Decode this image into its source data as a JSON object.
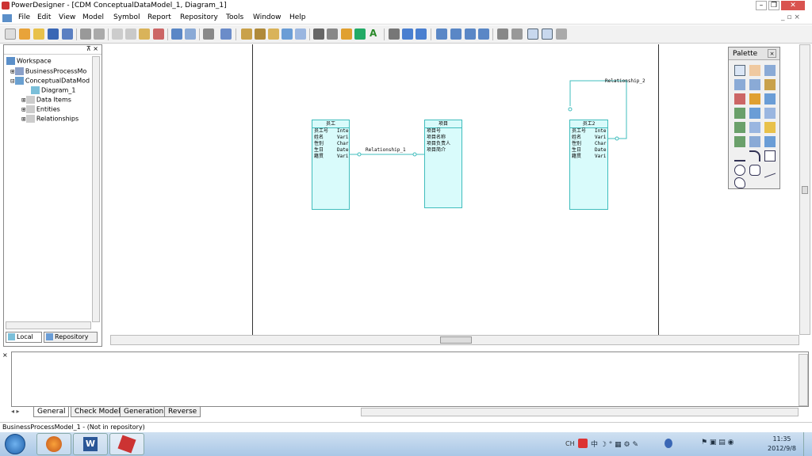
{
  "app": {
    "title": "PowerDesigner - [CDM ConceptualDataModel_1, Diagram_1]"
  },
  "menu": [
    "File",
    "Edit",
    "View",
    "Model",
    "Symbol",
    "Report",
    "Repository",
    "Tools",
    "Window",
    "Help"
  ],
  "tree": {
    "items": [
      {
        "label": "Workspace"
      },
      {
        "label": "BusinessProcessMo"
      },
      {
        "label": "ConceptualDataMod"
      },
      {
        "label": "Diagram_1"
      },
      {
        "label": "Data Items"
      },
      {
        "label": "Entities"
      },
      {
        "label": "Relationships"
      }
    ],
    "tabs": [
      "Local",
      "Repository"
    ]
  },
  "entities": [
    {
      "name": "员工",
      "rows": [
        [
          "员工号",
          "Inte"
        ],
        [
          "姓名",
          "Vari"
        ],
        [
          "性别",
          "Char"
        ],
        [
          "生日",
          "Date"
        ],
        [
          "籍贯",
          "Vari"
        ]
      ]
    },
    {
      "name": "项目",
      "rows": [
        [
          "项目号",
          ""
        ],
        [
          "项目名称",
          ""
        ],
        [
          "项目负责人",
          ""
        ],
        [
          "项目简介",
          ""
        ]
      ]
    },
    {
      "name": "员工2",
      "rows": [
        [
          "员工号",
          "Inte"
        ],
        [
          "姓名",
          "Vari"
        ],
        [
          "性别",
          "Char"
        ],
        [
          "生日",
          "Date"
        ],
        [
          "籍贯",
          "Vari"
        ]
      ]
    }
  ],
  "relationships": [
    "Relationship_1",
    "Relationship_2"
  ],
  "palette": {
    "title": "Palette"
  },
  "output": {
    "tabs": [
      "General",
      "Check Model",
      "Generation",
      "Reverse"
    ]
  },
  "status": {
    "text": "BusinessProcessModel_1 - (Not in repository)"
  },
  "taskbar": {
    "time": "11:35",
    "date": "2012/9/8",
    "lang": "CH"
  }
}
